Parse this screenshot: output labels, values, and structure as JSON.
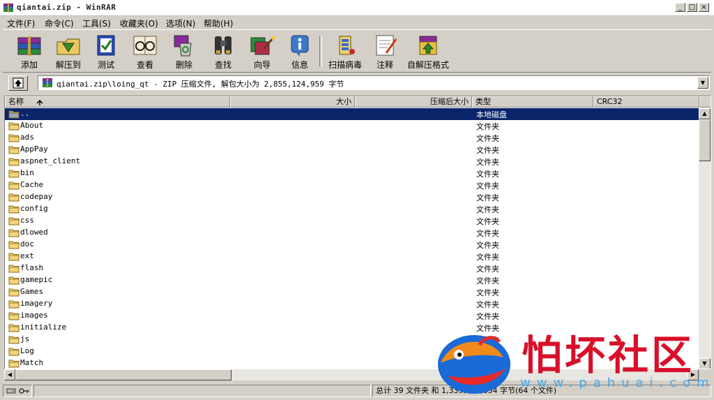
{
  "window": {
    "title": "qiantai.zip - WinRAR"
  },
  "menu": [
    {
      "label": "文件(F)"
    },
    {
      "label": "命令(C)"
    },
    {
      "label": "工具(S)"
    },
    {
      "label": "收藏夹(O)"
    },
    {
      "label": "选项(N)"
    },
    {
      "label": "帮助(H)"
    }
  ],
  "toolbar": [
    {
      "label": "添加",
      "icon": "books-add-icon"
    },
    {
      "label": "解压到",
      "icon": "extract-folder-icon"
    },
    {
      "label": "测试",
      "icon": "test-book-icon"
    },
    {
      "label": "查看",
      "icon": "glasses-view-icon"
    },
    {
      "label": "删除",
      "icon": "recycle-delete-icon"
    },
    {
      "label": "查找",
      "icon": "binoculars-find-icon"
    },
    {
      "label": "向导",
      "icon": "wizard-wand-icon"
    },
    {
      "label": "信息",
      "icon": "info-icon"
    },
    {
      "label": "扫描病毒",
      "icon": "virus-scan-icon"
    },
    {
      "label": "注释",
      "icon": "comment-pen-icon"
    },
    {
      "label": "自解压格式",
      "icon": "sfx-box-icon"
    }
  ],
  "address": {
    "path": "qiantai.zip\\loing_qt - ZIP 压缩文件, 解包大小为 2,855,124,959 字节"
  },
  "columns": [
    {
      "label": "名称"
    },
    {
      "label": "大小"
    },
    {
      "label": "压缩后大小"
    },
    {
      "label": "类型"
    },
    {
      "label": "CRC32"
    }
  ],
  "rows": [
    {
      "name": "..",
      "type": "本地磁盘",
      "selected": true
    },
    {
      "name": "About",
      "type": "文件夹"
    },
    {
      "name": "ads",
      "type": "文件夹"
    },
    {
      "name": "AppPay",
      "type": "文件夹"
    },
    {
      "name": "aspnet_client",
      "type": "文件夹"
    },
    {
      "name": "bin",
      "type": "文件夹"
    },
    {
      "name": "Cache",
      "type": "文件夹"
    },
    {
      "name": "codepay",
      "type": "文件夹"
    },
    {
      "name": "config",
      "type": "文件夹"
    },
    {
      "name": "css",
      "type": "文件夹"
    },
    {
      "name": "dlowed",
      "type": "文件夹"
    },
    {
      "name": "doc",
      "type": "文件夹"
    },
    {
      "name": "ext",
      "type": "文件夹"
    },
    {
      "name": "flash",
      "type": "文件夹"
    },
    {
      "name": "gamepic",
      "type": "文件夹"
    },
    {
      "name": "Games",
      "type": "文件夹"
    },
    {
      "name": "imagery",
      "type": "文件夹"
    },
    {
      "name": "images",
      "type": "文件夹"
    },
    {
      "name": "initialize",
      "type": "文件夹"
    },
    {
      "name": "js",
      "type": "文件夹"
    },
    {
      "name": "Log",
      "type": "文件夹"
    },
    {
      "name": "Match",
      "type": "文件夹"
    }
  ],
  "status": {
    "summary": "总计 39 文件夹 和 1,339,857,654 字节(64 个文件)"
  },
  "watermark": {
    "text": "怕坏社区",
    "url": "www.pahuai.com"
  },
  "colors": {
    "selection": "#0a246a",
    "watermark_red": "#d8102a",
    "watermark_blue": "#4aa8e8",
    "folder_yellow": "#f4d47c"
  }
}
